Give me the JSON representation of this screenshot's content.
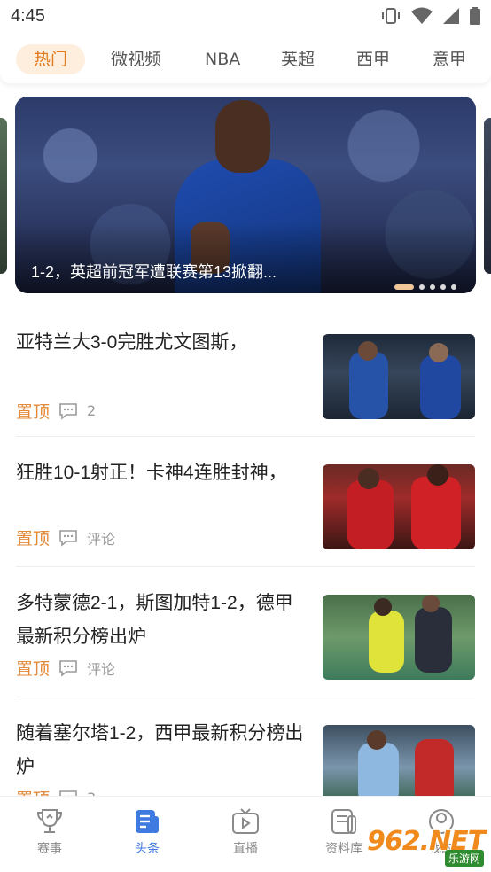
{
  "status_bar": {
    "time": "4:45"
  },
  "tabs": [
    {
      "label": "热门",
      "active": true
    },
    {
      "label": "微视频"
    },
    {
      "label": "NBA"
    },
    {
      "label": "英超"
    },
    {
      "label": "西甲"
    },
    {
      "label": "意甲"
    }
  ],
  "banner": {
    "caption": "1-2，英超前冠军遭联赛第13掀翻...",
    "slide_count": 5,
    "active_slide": 1
  },
  "news": [
    {
      "title": "亚特兰大3-0完胜尤文图斯，",
      "badge": "置顶",
      "comments": "2"
    },
    {
      "title": "狂胜10-1射正！卡神4连胜封神，",
      "badge": "置顶",
      "comments": "评论"
    },
    {
      "title": "多特蒙德2-1，斯图加特1-2，德甲最新积分榜出炉",
      "badge": "置顶",
      "comments": "评论"
    },
    {
      "title": "随着塞尔塔1-2，西甲最新积分榜出炉",
      "badge": "置顶",
      "comments": "3"
    }
  ],
  "bottom_nav": [
    {
      "label": "赛事",
      "icon": "trophy-icon"
    },
    {
      "label": "头条",
      "icon": "news-icon",
      "active": true
    },
    {
      "label": "直播",
      "icon": "tv-play-icon"
    },
    {
      "label": "资料库",
      "icon": "database-icon"
    },
    {
      "label": "我的",
      "icon": "user-icon"
    }
  ],
  "watermark": {
    "text": "962.NET",
    "sub": "乐游网"
  },
  "colors": {
    "accent": "#e3893a",
    "tab_active_bg": "#fdeede",
    "nav_active": "#3f7ae0"
  }
}
